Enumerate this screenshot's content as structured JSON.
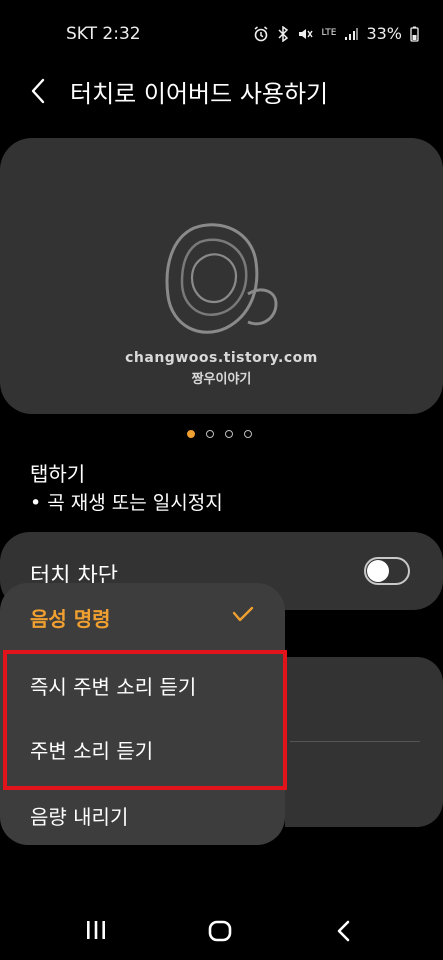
{
  "status_bar": {
    "carrier_time": "SKT 2:32",
    "network": "LTE",
    "battery": "33%"
  },
  "header": {
    "title": "터치로 이어버드 사용하기"
  },
  "illustration": {
    "watermark_url": "changwoos.tistory.com",
    "watermark_name": "짱우이야기"
  },
  "pager": {
    "count": 4,
    "active_index": 0
  },
  "gesture": {
    "title": "탭하기",
    "description": "• 곡 재생 또는 일시정지"
  },
  "touch_block": {
    "label": "터치 차단",
    "enabled": false
  },
  "dropdown_menu": {
    "items": [
      {
        "label": "음성 명령",
        "selected": true
      },
      {
        "label": "즉시 주변 소리 듣기",
        "selected": false
      },
      {
        "label": "주변 소리 듣기",
        "selected": false
      },
      {
        "label": "음량 내리기",
        "selected": false
      }
    ]
  },
  "colors": {
    "accent": "#f0a030",
    "highlight": "#e3131c",
    "card": "#333333",
    "menu": "#3d3d3d"
  },
  "nav_bar": {
    "icons": [
      "recent-apps-icon",
      "home-icon",
      "back-icon"
    ]
  }
}
